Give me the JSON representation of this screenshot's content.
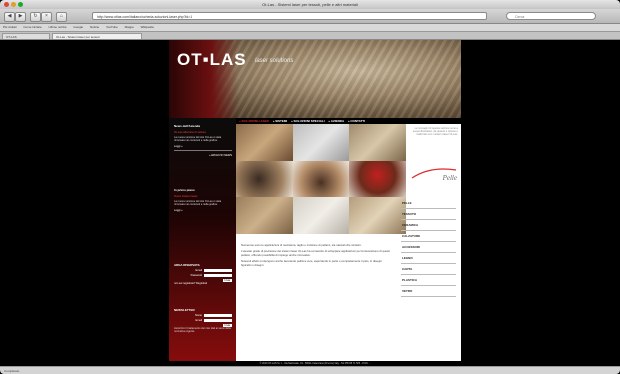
{
  "browser": {
    "window_title": "Ot-Las - Sistemi laser per tessuti, pelle e altri materiali",
    "url": "http://www.otlas.com/italiano/scheda-soluzioni-laser.php?id=1",
    "search_placeholder": "Cerca",
    "bookmarks": [
      "Più visitati",
      "Come iniziare",
      "Ultime notizie",
      "Google",
      "Notizie",
      "YouTube",
      "Mappe",
      "Wikipedia"
    ],
    "tabs": [
      "OT-LAS",
      "Ot-Las - Sistemi laser per tessuti"
    ]
  },
  "site": {
    "logo": "OT▪LAS",
    "logo_sub": "laser solutions",
    "menu": [
      {
        "label": "» SOLUZIONI LASER",
        "accent": true
      },
      {
        "label": "» SISTEMI",
        "accent": false
      },
      {
        "label": "» SOLUZIONI SPECIALI",
        "accent": false
      },
      {
        "label": "» AZIENDA",
        "accent": false
      },
      {
        "label": "» CONTATTI",
        "accent": false
      }
    ],
    "sidebar": {
      "news_head": "News dell'Azienda",
      "news_red": "Ot-Las alla fiera di settore",
      "news_text": "La nuova versione del sito Ot-Las è stata rinnovata nei contenuti e nella grafica.",
      "news_link": "Leggi »",
      "archive_link": "» ARCHIVIO NEWS",
      "front_head": "In primo piano",
      "front_red": "Nuovi sistemi laser",
      "front_text": "La nuova versione del sito Ot-Las è stata rinnovata nei contenuti e nella grafica.",
      "front_link": "Leggi »",
      "reserved_head": "AREA RISERVATA",
      "email_label": "Email",
      "password_label": "Password",
      "login_button": "Invia",
      "register_link": "non sei registrato? Registrati",
      "newsletter_head": "NEWSLETTER",
      "name_label": "Nome",
      "nl_email_label": "Email",
      "nl_button": "Invia",
      "privacy_text": "Autorizzo il trattamento dei miei dati ai sensi della normativa vigente"
    },
    "pelle_panel": {
      "text": "Le immagini di questa sezione sono a scopo illustrativo, da quanto è ripreso e realizzato con i sistemi laser Ot-Las.",
      "title": "Pelle"
    },
    "categories": [
      "PELLE",
      "TESSUTO",
      "CERAMICA",
      "CALZATURE",
      "ACCESSORI",
      "LEGNO",
      "CARTA",
      "PLASTICA",
      "VETRO"
    ],
    "content_paragraphs": [
      "Numerose sono le applicazioni di marcatura, taglio e incisione di pellami, sia naturali che sintetici.",
      "L'elevato grado di precisione dei sistemi laser Ot-Las ha consentito di sviluppare applicazioni per la lavorazione di questi pellami, offrendo possibilità di impiego anche innovative.",
      "Notevoli effetti si ottengono anche lavorando pellicce vere, asportando in parte o completamente il pelo, in disegni figurativi o disegni."
    ],
    "footer": "© 2010 OT-LAS S.r.l. - Via Nazionale, 31 - 50041 Calenzano (Firenze) Italy - Tel 055 88 71 525 - P.IVA ..."
  },
  "status_bar": "Completato",
  "colors": {
    "accent_red": "#e02a2a",
    "sidebar_dark": "#1e0404"
  }
}
